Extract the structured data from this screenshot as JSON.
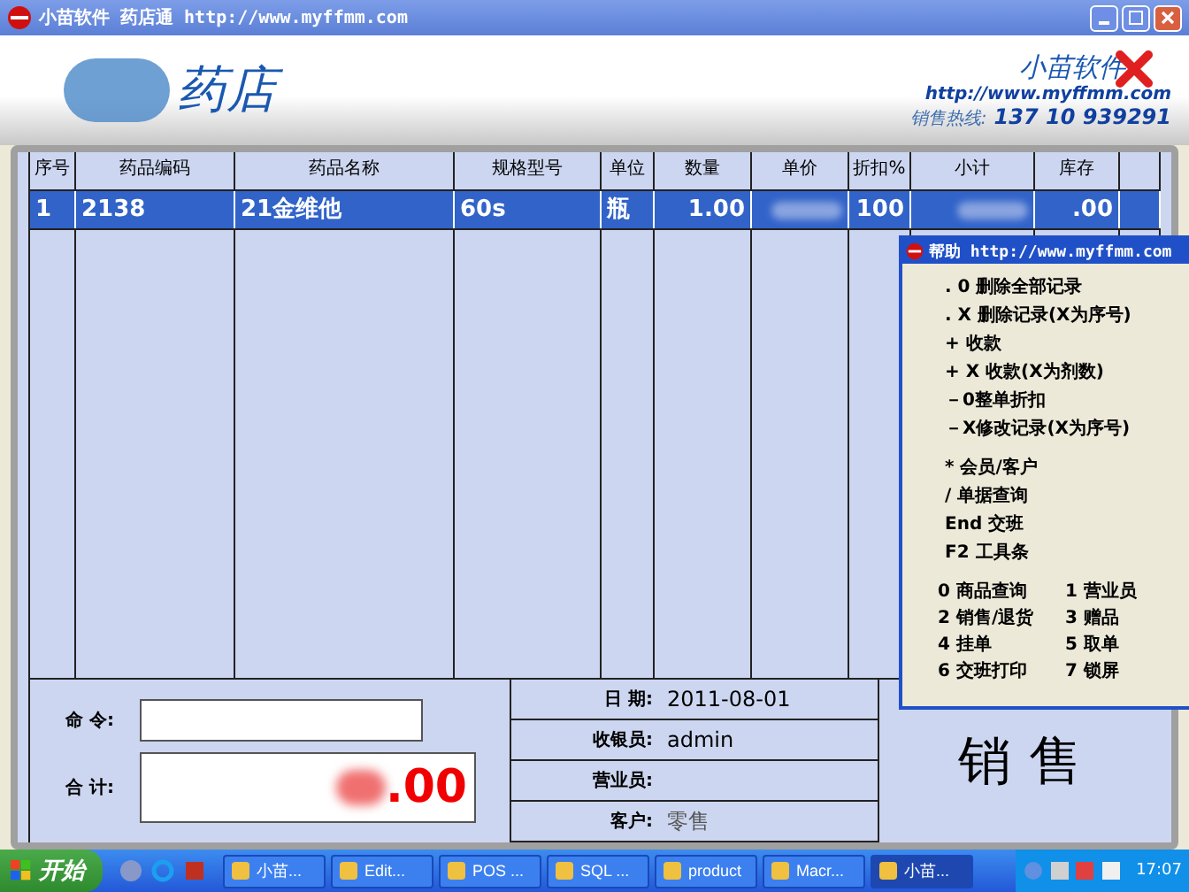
{
  "window": {
    "title": "小苗软件 药店通 http://www.myffmm.com"
  },
  "banner": {
    "title": "药店",
    "brand": "小苗软件",
    "url": "http://www.myffmm.com",
    "hotline_label": "销售热线:",
    "hotline": "137 10 939291"
  },
  "table": {
    "columns": [
      "序号",
      "药品编码",
      "药品名称",
      "规格型号",
      "单位",
      "数量",
      "单价",
      "折扣%",
      "小计",
      "库存"
    ],
    "rows": [
      {
        "selected": true,
        "cells": [
          "1",
          "2138",
          "21金维他",
          "60s",
          "瓶",
          "1.00",
          null,
          "100",
          null,
          ".00"
        ]
      }
    ]
  },
  "bottom": {
    "command_label": "命 令:",
    "total_label": "合 计:",
    "total_value": ".00",
    "info": [
      {
        "label": "日 期:",
        "value": "2011-08-01"
      },
      {
        "label": "收银员:",
        "value": "admin"
      },
      {
        "label": "营业员:"
      },
      {
        "label": "客户:",
        "value": "零售"
      }
    ],
    "mode": "销 售"
  },
  "help": {
    "title": "帮助 http://www.myffmm.com",
    "commands": [
      ". 0 删除全部记录",
      ". X 删除记录(X为序号)",
      "+ 收款",
      "+ X 收款(X为剂数)",
      "－0整单折扣",
      "－X修改记录(X为序号)"
    ],
    "shortcuts": [
      "* 会员/客户",
      "/ 单据查询",
      "End 交班",
      "F2 工具条"
    ],
    "keys": [
      "0 商品查询",
      "1 营业员",
      "2 销售/退货",
      "3 赠品",
      "4 挂单",
      "5 取单",
      "6 交班打印",
      "7 锁屏"
    ]
  },
  "taskbar": {
    "start": "开始",
    "tasks": [
      {
        "label": "小苗...",
        "selected": false
      },
      {
        "label": "Edit...",
        "selected": false
      },
      {
        "label": "POS ...",
        "selected": false
      },
      {
        "label": "SQL ...",
        "selected": false
      },
      {
        "label": "product",
        "selected": false
      },
      {
        "label": "Macr...",
        "selected": false
      },
      {
        "label": "小苗...",
        "selected": true
      }
    ],
    "clock": "17:07"
  }
}
